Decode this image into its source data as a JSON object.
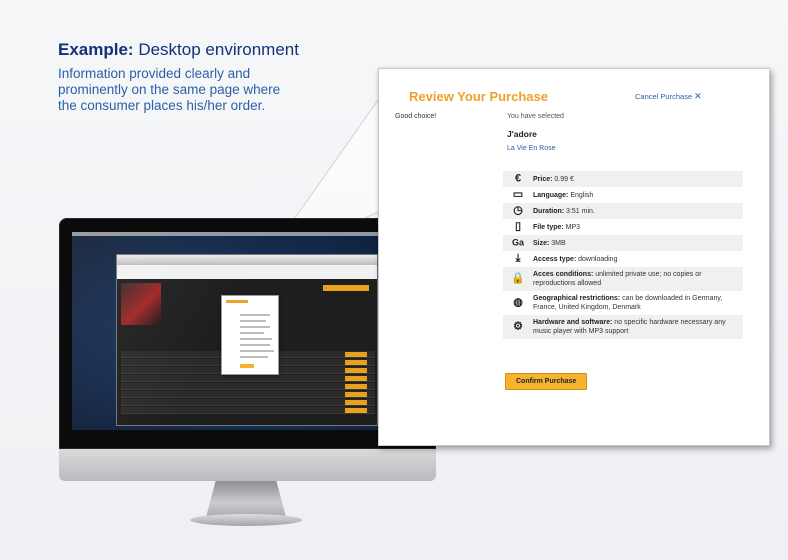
{
  "slide": {
    "heading_bold": "Example:",
    "heading_rest": " Desktop environment",
    "description": "Information provided clearly and prominently on the same page where the consumer places his/her order."
  },
  "panel": {
    "title": "Review Your Purchase",
    "cancel_label": "Cancel Purchase",
    "cancel_icon": "close-icon",
    "good_choice": "Good choice!",
    "selected_label": "You have selected",
    "track_title": "J'adore",
    "album": "La Vie En Rose",
    "rows": [
      {
        "icon": "euro-icon",
        "glyph": "€",
        "label": "Price:",
        "value": " 0.99 €"
      },
      {
        "icon": "speech-bubble-icon",
        "glyph": "💬",
        "label": "Language:",
        "value": " English"
      },
      {
        "icon": "stopwatch-icon",
        "glyph": "⏱",
        "label": "Duration:",
        "value": " 3:51 min."
      },
      {
        "icon": "file-icon",
        "glyph": "🗎",
        "label": "File type:",
        "value": " MP3"
      },
      {
        "icon": "size-icon",
        "glyph": "Ga",
        "label": "Size:",
        "value": " 3MB"
      },
      {
        "icon": "download-icon",
        "glyph": "⤓",
        "label": "Access type:",
        "value": " downloading"
      },
      {
        "icon": "padlock-icon",
        "glyph": "🔒",
        "label": "Acces conditions:",
        "value": " unlimited private use; no copies or reproductions allowed"
      },
      {
        "icon": "globe-icon",
        "glyph": "🌐",
        "label": "Geographical restrictions:",
        "value": " can be downloaded in Germany, France, United Kingdom, Denmark"
      },
      {
        "icon": "gears-icon",
        "glyph": "⚙",
        "label": "Hardware and software:",
        "value": " no specific hardware necessary any music player with MP3 support"
      }
    ],
    "confirm_label": "Confirm Purchase"
  },
  "colors": {
    "heading": "#14307a",
    "description": "#2b5fa6",
    "accent_orange": "#f0a02a",
    "button_orange": "#f6b330",
    "link_blue": "#2b5fa6"
  }
}
